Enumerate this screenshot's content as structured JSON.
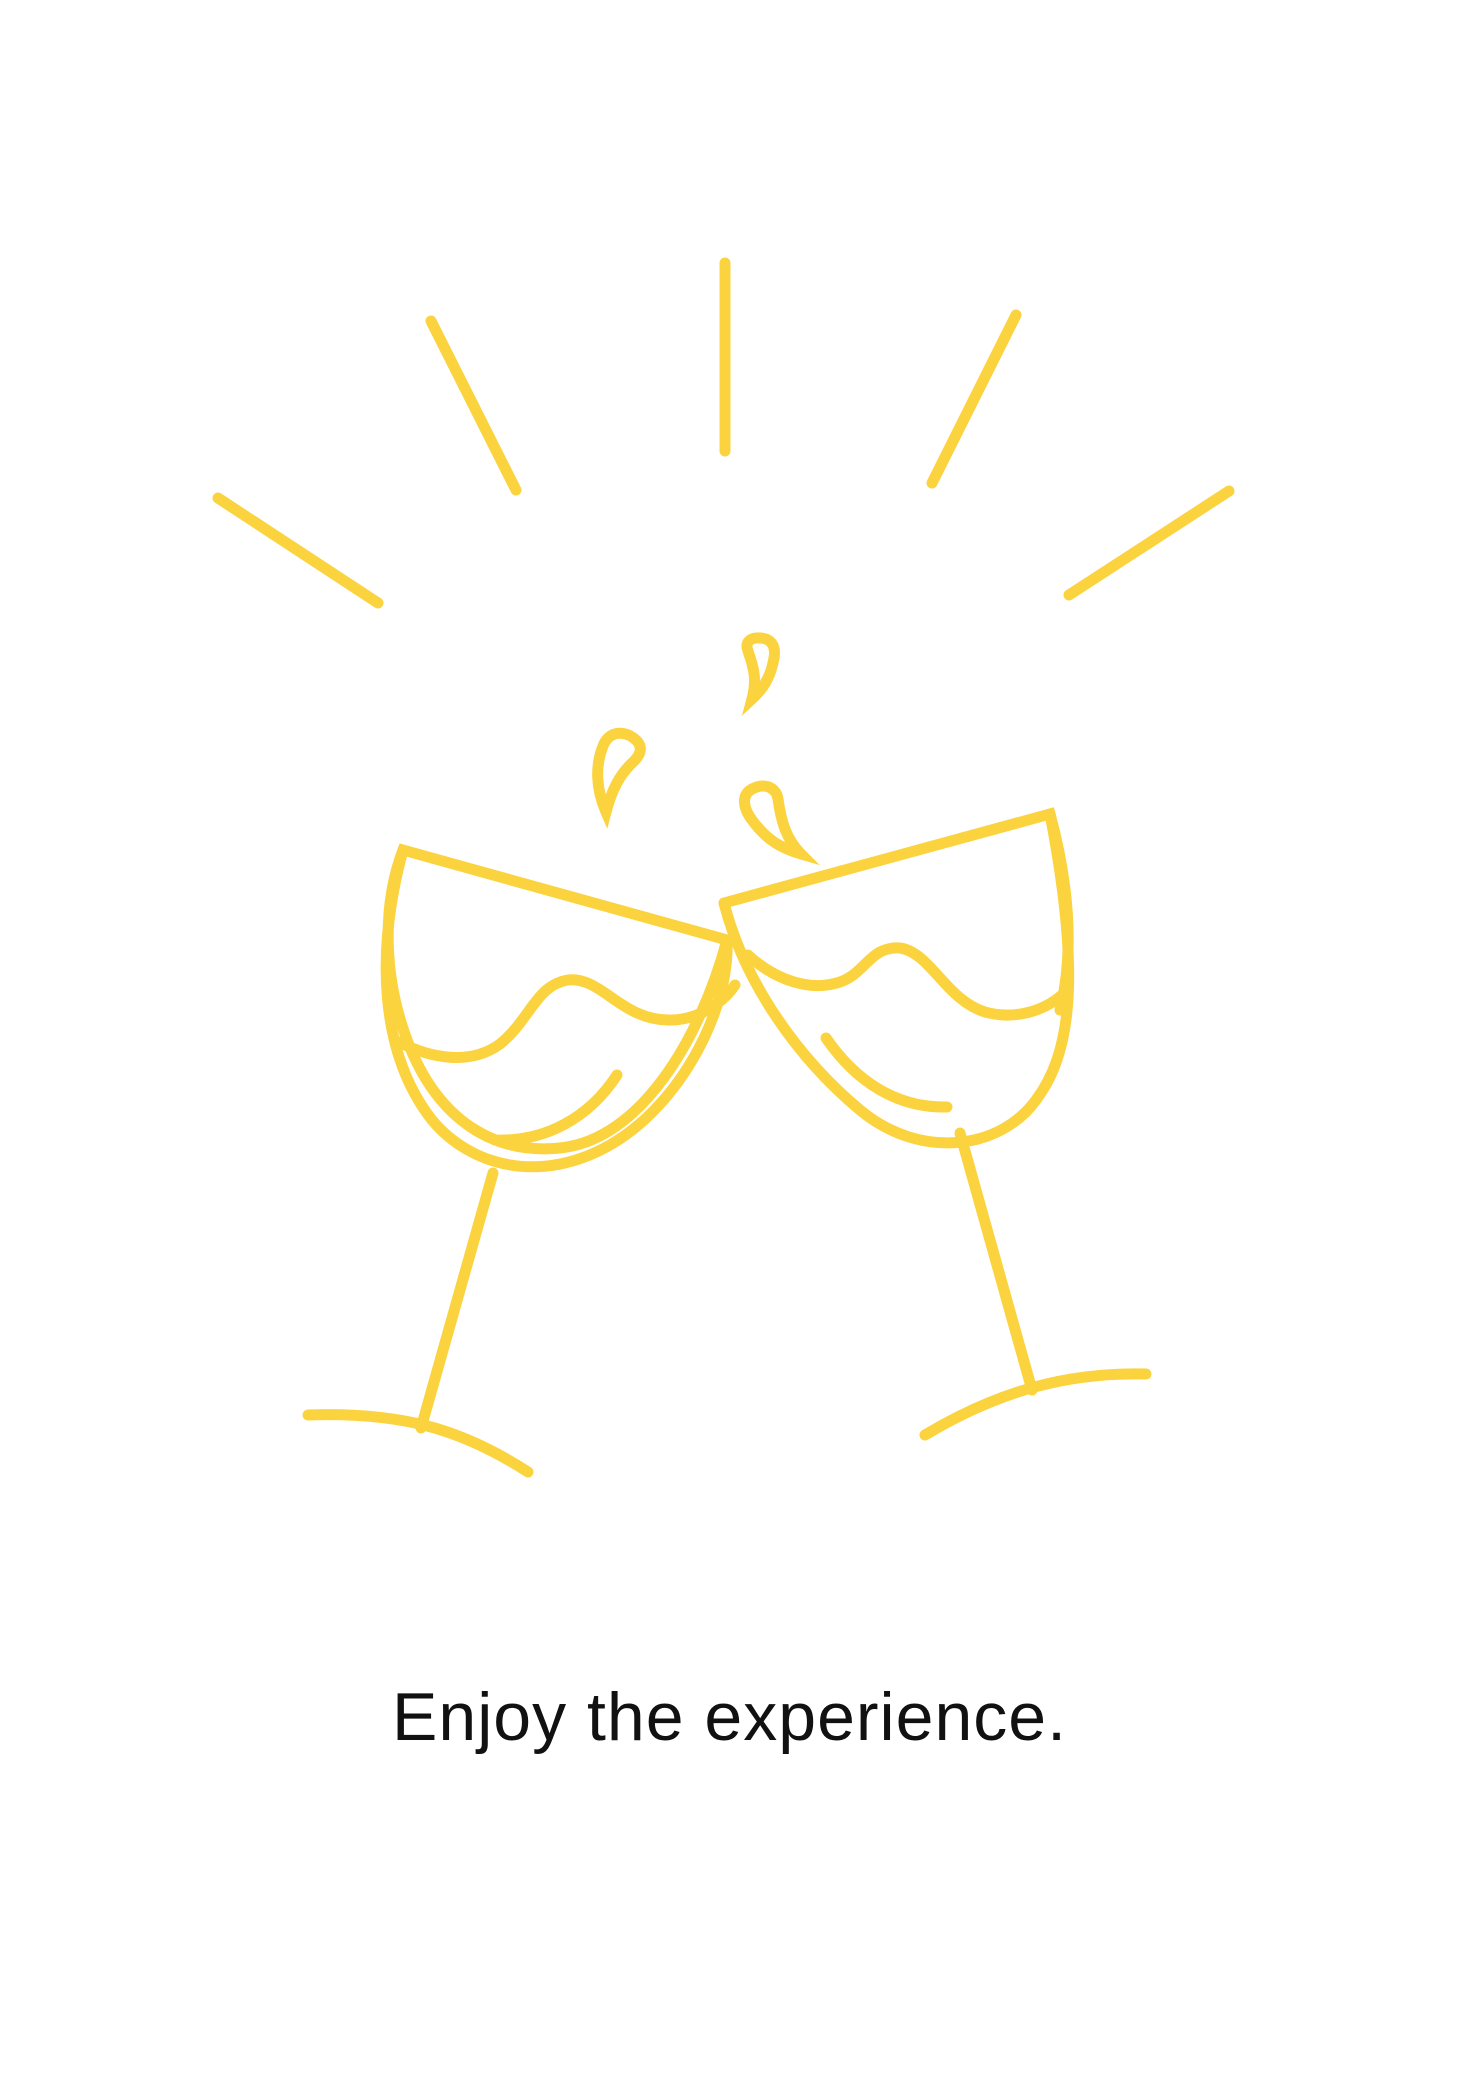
{
  "caption": "Enjoy the experience.",
  "colors": {
    "accent": "#fbd33f",
    "background": "#ffffff",
    "text": "#111111"
  },
  "illustration": {
    "icon": "toasting-glasses-icon",
    "rays_count": 5,
    "droplets_count": 3,
    "glasses_count": 2
  }
}
